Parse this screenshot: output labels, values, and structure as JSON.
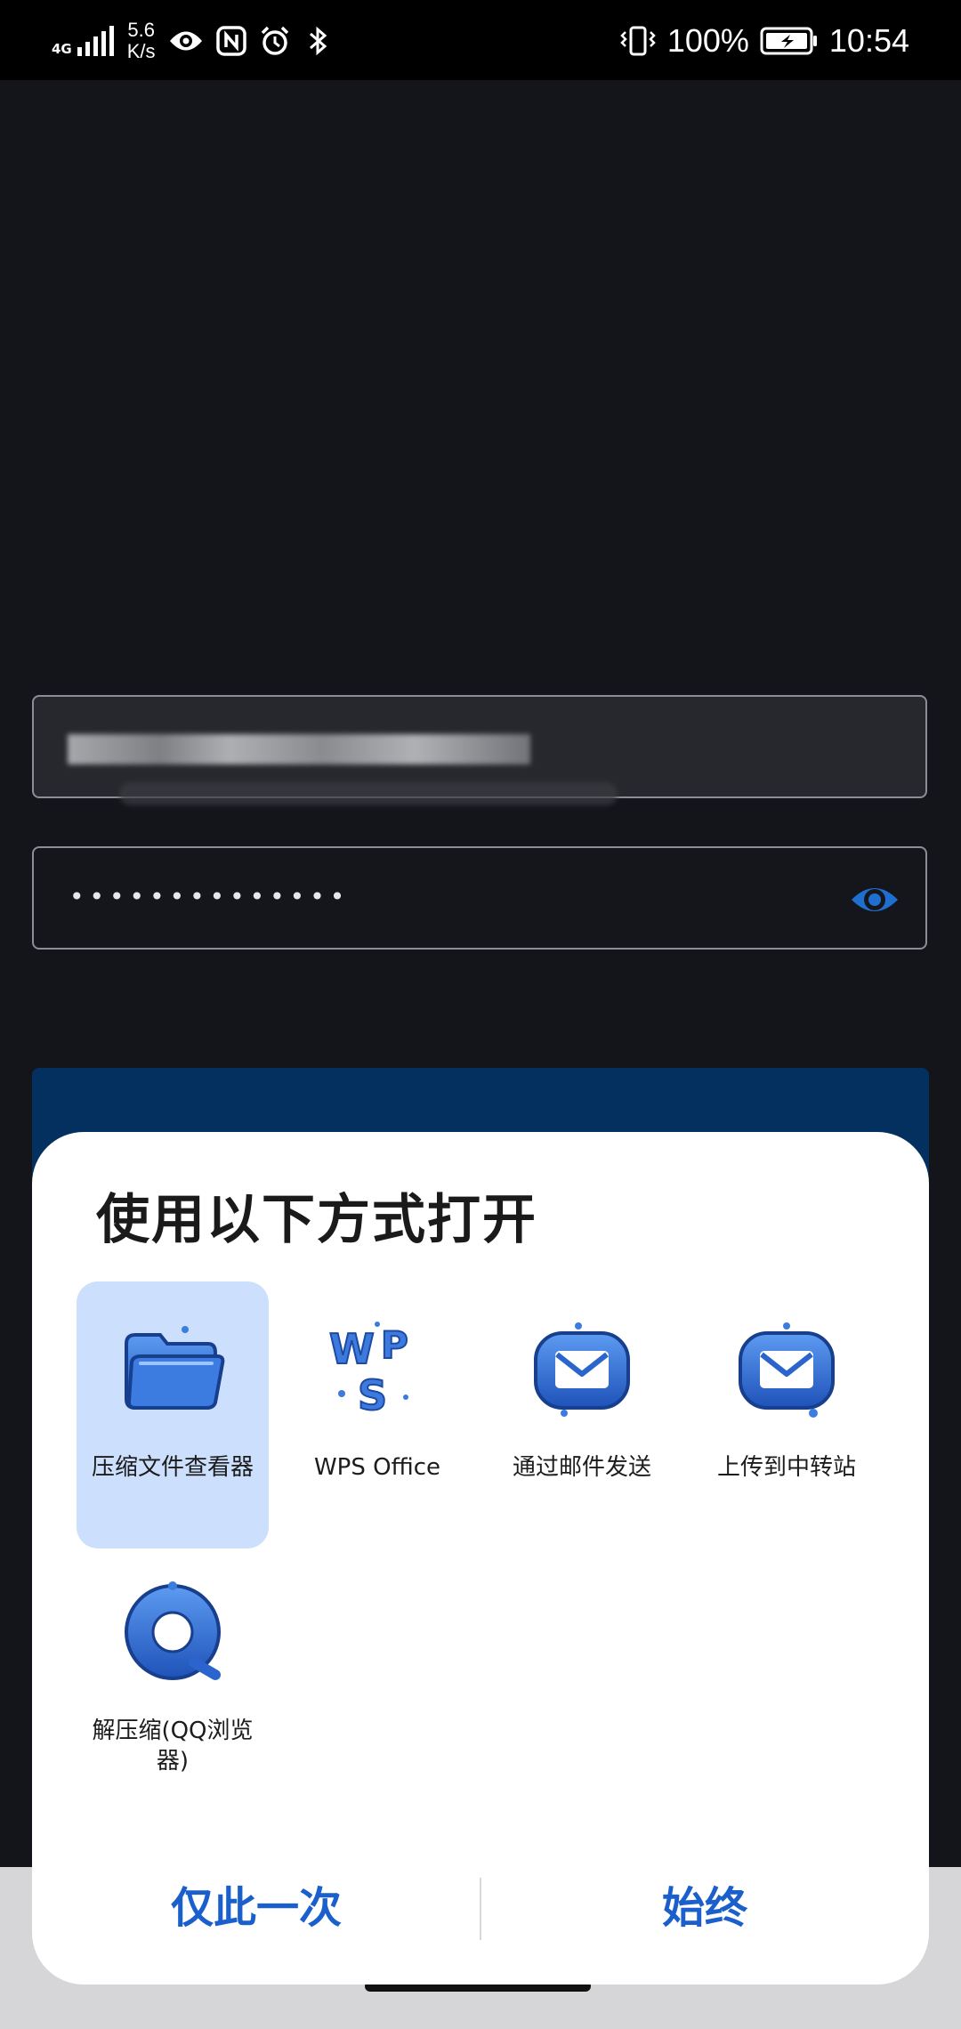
{
  "status_bar": {
    "network_type": "4G",
    "net_speed_value": "5.6",
    "net_speed_unit": "K/s",
    "battery_percent": "100%",
    "time": "10:54",
    "icons": [
      "signal-icon",
      "eye-icon",
      "nfc-icon",
      "alarm-icon",
      "bluetooth-icon",
      "vibrate-icon",
      "battery-charging-icon"
    ]
  },
  "login": {
    "password_mask": "••••••••••••••",
    "button_color": "#04305f"
  },
  "sheet": {
    "title": "使用以下方式打开",
    "apps": [
      {
        "label": "压缩文件查看器",
        "icon": "folder-icon",
        "selected": true
      },
      {
        "label": "WPS Office",
        "icon": "wps-icon",
        "selected": false
      },
      {
        "label": "通过邮件发送",
        "icon": "mail-icon",
        "selected": false
      },
      {
        "label": "上传到中转站",
        "icon": "mail-icon",
        "selected": false
      },
      {
        "label": "解压缩(QQ浏览器)",
        "icon": "qq-browser-icon",
        "selected": false
      }
    ],
    "once_label": "仅此一次",
    "always_label": "始终",
    "accent": "#1a5fcc",
    "selected_bg": "#ccdffc"
  }
}
